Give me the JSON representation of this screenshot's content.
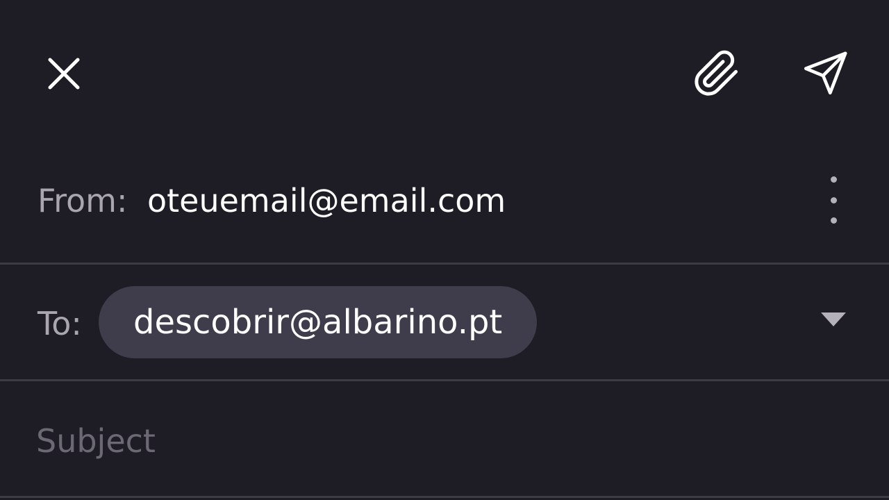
{
  "toolbar": {
    "close_icon": "close-icon",
    "attach_icon": "paperclip-icon",
    "send_icon": "send-icon"
  },
  "from": {
    "label": "From:",
    "value": "oteuemail@email.com",
    "more_icon": "more-vertical-icon"
  },
  "to": {
    "label": "To:",
    "recipient": "descobrir@albarino.pt",
    "dropdown_icon": "triangle-down-icon"
  },
  "subject": {
    "placeholder": "Subject",
    "value": ""
  },
  "colors": {
    "background": "#1e1c25",
    "chip": "#3f3c4b",
    "divider": "#3d3b44",
    "label": "#a9a6b0",
    "placeholder": "#6c6974",
    "text": "#ffffff"
  }
}
